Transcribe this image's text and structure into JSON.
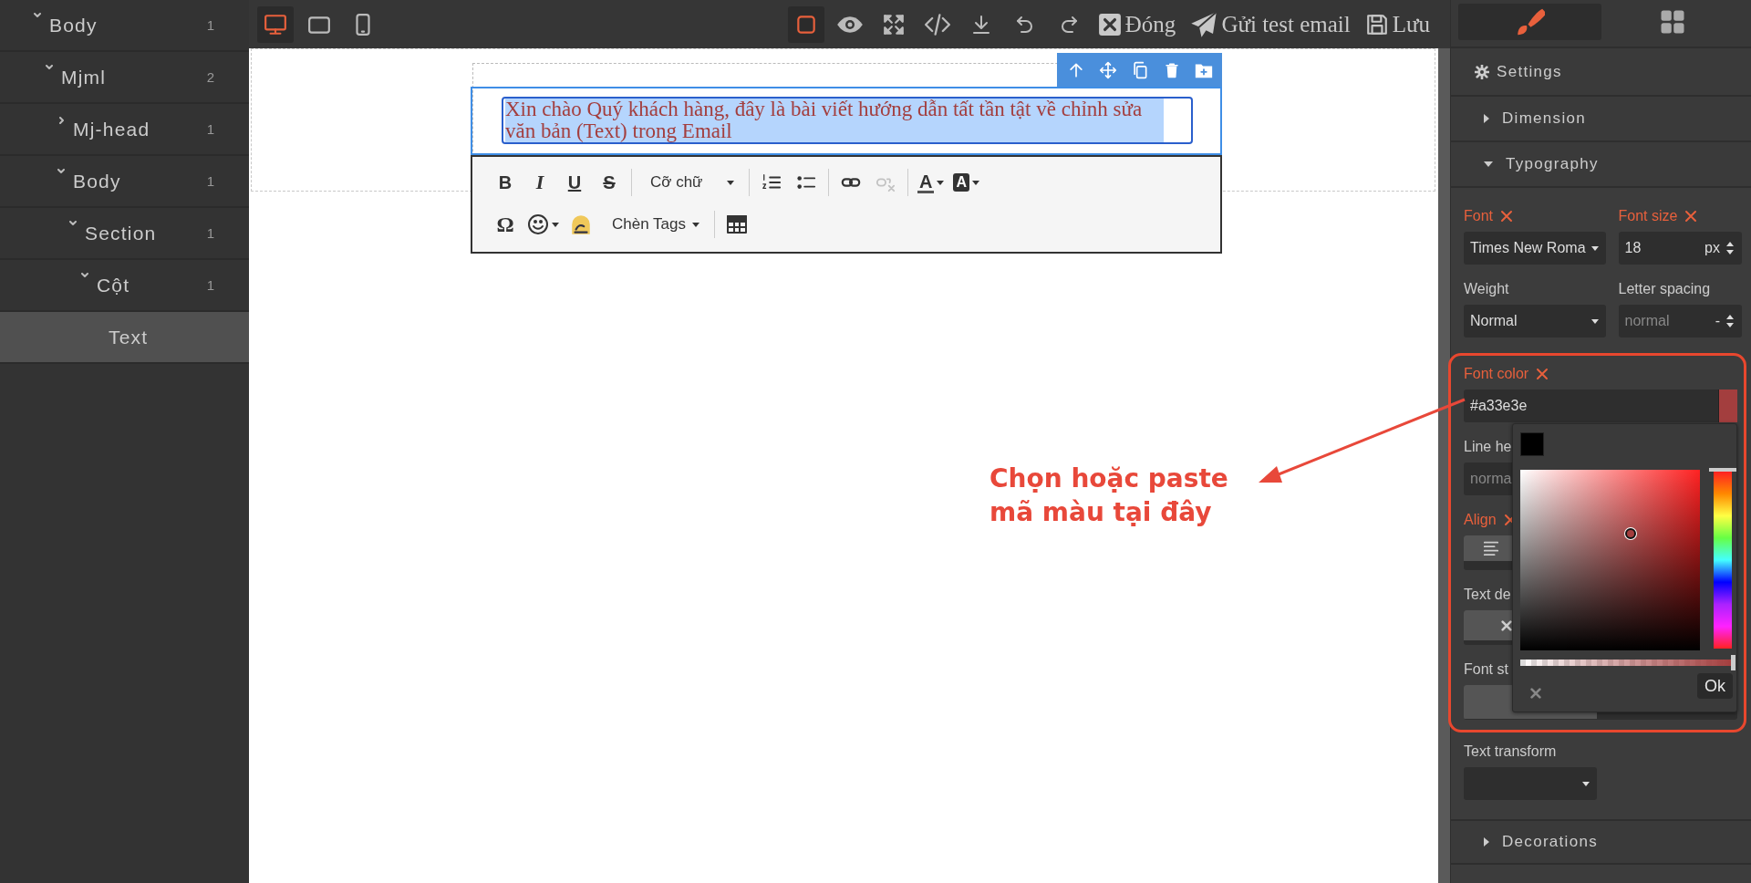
{
  "layers": [
    {
      "label": "Body",
      "count": "1",
      "expanded": true,
      "selected": false,
      "children": [
        {
          "label": "Mjml",
          "count": "2",
          "expanded": true,
          "selected": false,
          "children": [
            {
              "label": "Mj-head",
              "count": "1",
              "expanded": false,
              "selected": false
            },
            {
              "label": "Body",
              "count": "1",
              "expanded": true,
              "selected": false,
              "children": [
                {
                  "label": "Section",
                  "count": "1",
                  "expanded": true,
                  "selected": false,
                  "children": [
                    {
                      "label": "Cột",
                      "count": "1",
                      "expanded": true,
                      "selected": false,
                      "children": [
                        {
                          "label": "Text",
                          "selected": true
                        }
                      ]
                    }
                  ]
                }
              ]
            }
          ]
        }
      ]
    }
  ],
  "topbar": {
    "devices": [
      {
        "kind": "desktop",
        "selected": true
      },
      {
        "kind": "tablet",
        "selected": false
      },
      {
        "kind": "mobile",
        "selected": false
      }
    ],
    "tools": [
      {
        "kind": "borders",
        "active": true
      },
      {
        "kind": "preview",
        "active": false
      },
      {
        "kind": "fullscreen",
        "active": false
      },
      {
        "kind": "code",
        "active": false
      },
      {
        "kind": "export",
        "active": false
      },
      {
        "kind": "undo",
        "active": false
      },
      {
        "kind": "redo",
        "active": false
      }
    ],
    "buttons": [
      {
        "kind": "close",
        "label": "Đóng"
      },
      {
        "kind": "send",
        "label": "Gửi test email"
      },
      {
        "kind": "save",
        "label": "Lưu"
      }
    ]
  },
  "canvas": {
    "text": "Xin chào Quý khách hàng, đây là bài viết hướng dẫn tất tần tật về chỉnh sửa văn bản (Text) trong Email",
    "block_tools": [
      {
        "kind": "parent"
      },
      {
        "kind": "move"
      },
      {
        "kind": "clone"
      },
      {
        "kind": "delete"
      },
      {
        "kind": "save"
      }
    ],
    "rte_rows": [
      [
        [
          {
            "kind": "bold",
            "label": "B",
            "disabled": false
          },
          {
            "kind": "italic",
            "label": "I",
            "disabled": false
          },
          {
            "kind": "underline",
            "label": "U",
            "disabled": false
          },
          {
            "kind": "strike",
            "label": "S",
            "disabled": false
          }
        ],
        [
          {
            "kind": "dropdown",
            "label": "Cỡ chữ",
            "disabled": false
          }
        ],
        [
          {
            "kind": "ordered-list",
            "disabled": false
          },
          {
            "kind": "bullet-list",
            "disabled": false
          }
        ],
        [
          {
            "kind": "link",
            "disabled": false
          },
          {
            "kind": "unlink",
            "disabled": true
          }
        ],
        [
          {
            "kind": "text-color",
            "label": "A",
            "disabled": false
          },
          {
            "kind": "background-color",
            "label": "A",
            "disabled": false
          }
        ]
      ],
      [
        [
          {
            "kind": "special-char",
            "label": "Ω",
            "disabled": false
          },
          {
            "kind": "emoji",
            "disabled": false
          },
          {
            "kind": "marker",
            "disabled": false
          },
          {
            "kind": "dropdown",
            "label": "Chèn Tags",
            "disabled": false
          }
        ],
        [
          {
            "kind": "table",
            "disabled": false
          }
        ]
      ]
    ]
  },
  "panel": {
    "tabs": [
      {
        "kind": "style",
        "selected": true
      },
      {
        "kind": "blocks",
        "selected": false
      }
    ],
    "sectors": [
      {
        "kind": "settings",
        "label": "Settings"
      },
      {
        "kind": "sector",
        "label": "Dimension",
        "expanded": false
      },
      {
        "kind": "sector",
        "label": "Typography",
        "expanded": true
      }
    ],
    "properties": [
      {
        "kind": "select",
        "label": "Font",
        "modified": true,
        "value": "Times New Roma"
      },
      {
        "kind": "number",
        "label": "Font size",
        "modified": true,
        "value": "18",
        "unit": "px"
      },
      {
        "kind": "select",
        "label": "Weight",
        "modified": false,
        "value": "Normal"
      },
      {
        "kind": "number",
        "label": "Letter spacing",
        "modified": false,
        "placeholder": "normal",
        "unit": "-"
      }
    ],
    "annotation_box": {
      "properties": [
        {
          "kind": "color",
          "label": "Font color",
          "modified": true,
          "value": "#a33e3e"
        },
        {
          "kind": "number",
          "label": "Line he",
          "modified": false,
          "placeholder": "norma"
        },
        {
          "kind": "radio",
          "label": "Align",
          "modified": true,
          "options": [
            {
              "kind": "align-left",
              "selected": true
            }
          ]
        },
        {
          "kind": "radio",
          "label": "Text de",
          "modified": false,
          "options": [
            {
              "kind": "none",
              "selected": true
            }
          ]
        },
        {
          "kind": "radio",
          "label": "Font st",
          "modified": false,
          "options": [
            {
              "kind": "plain",
              "selected": true
            }
          ]
        }
      ],
      "color_picker": {
        "hue": {
          "level": 0
        },
        "alpha": {
          "level": 1
        },
        "ok_label": "Ok"
      }
    },
    "properties_after": [
      {
        "kind": "select",
        "label": "Text transform",
        "modified": false
      }
    ],
    "sectors_after": [
      {
        "kind": "sector",
        "label": "Decorations",
        "expanded": false
      }
    ]
  },
  "annotation": {
    "text": "Chọn hoặc paste mã màu tại đây"
  }
}
